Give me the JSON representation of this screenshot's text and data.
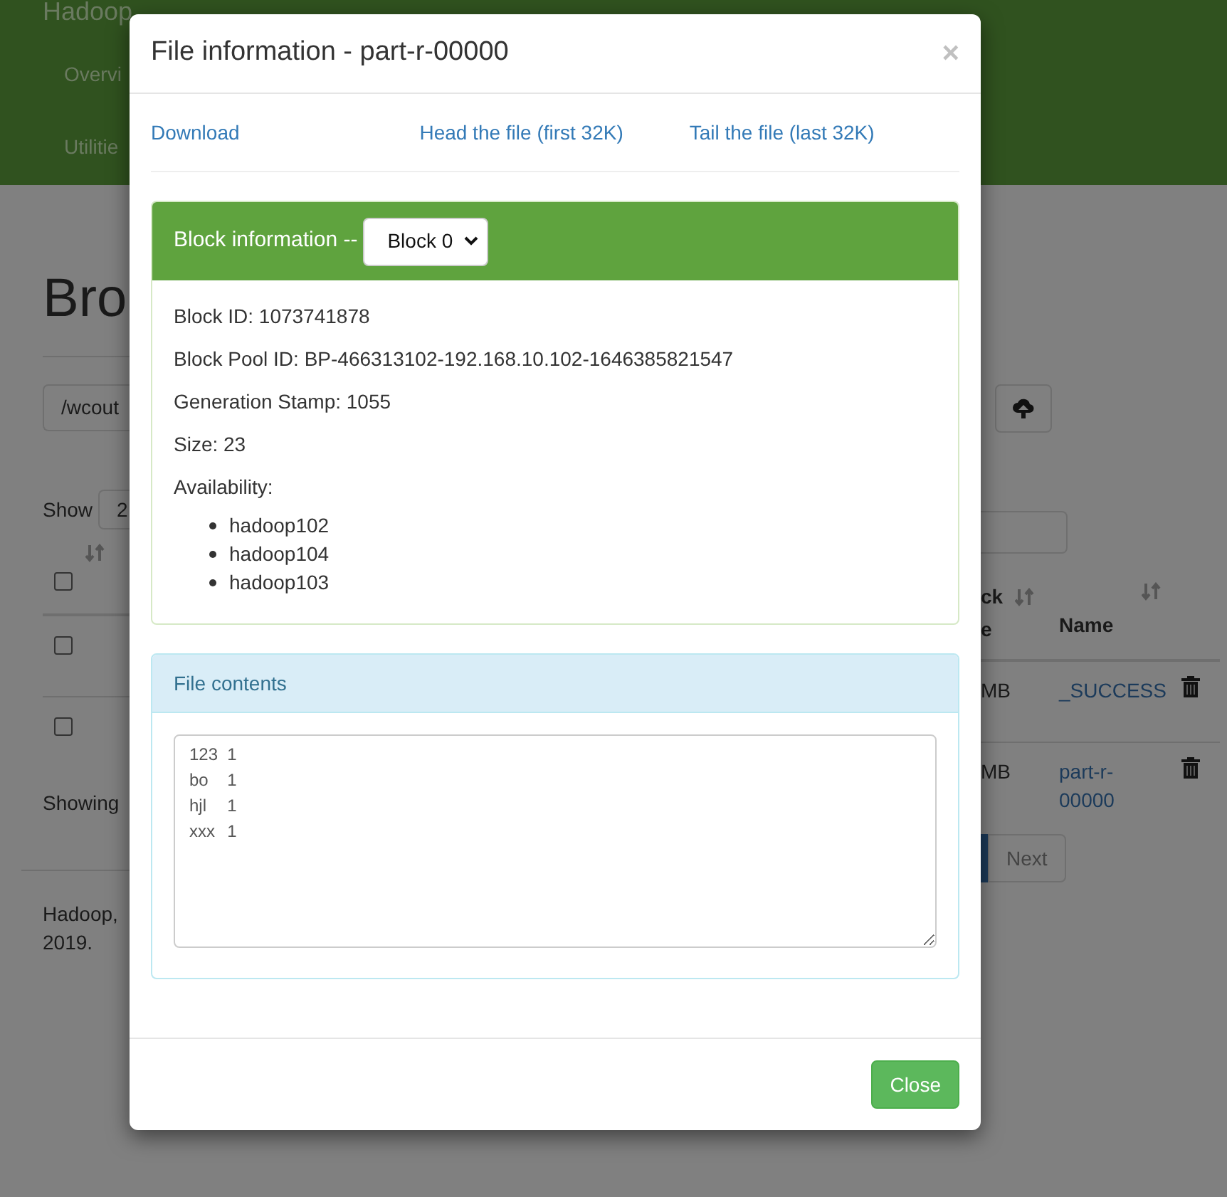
{
  "background": {
    "brand": "Hadoop",
    "nav": [
      "Overvi",
      "Utilitie"
    ],
    "page_title": "Bro",
    "path_field": {
      "value": "/wcout"
    },
    "show_label": "Show",
    "show_select": {
      "value": "2"
    },
    "select_all_checked": false,
    "header_fragment_1": "ck",
    "header_fragment_2": "e",
    "name_header": "Name",
    "rows": [
      {
        "size": "MB",
        "name": "_SUCCESS",
        "checked": false
      },
      {
        "size": "MB",
        "name": "part-r-00000",
        "checked": false
      }
    ],
    "showing": "Showing",
    "next_button": "Next",
    "footer": "Hadoop, 2019."
  },
  "modal": {
    "title": "File information - part-r-00000",
    "close_symbol": "×",
    "links": [
      "Download",
      "Head the file (first 32K)",
      "Tail the file (last 32K)"
    ],
    "block_panel": {
      "title": "Block information --",
      "select": {
        "value": "Block 0"
      },
      "fields": [
        "Block ID: 1073741878",
        "Block Pool ID: BP-466313102-192.168.10.102-1646385821547",
        "Generation Stamp: 1055",
        "Size: 23"
      ],
      "availability_label": "Availability:",
      "hosts": [
        "hadoop102",
        "hadoop104",
        "hadoop103"
      ]
    },
    "contents_panel": {
      "title": "File contents",
      "content": "123\t1\nbo\t1\nhjl\t1\nxxx\t1"
    },
    "close_button": "Close"
  }
}
